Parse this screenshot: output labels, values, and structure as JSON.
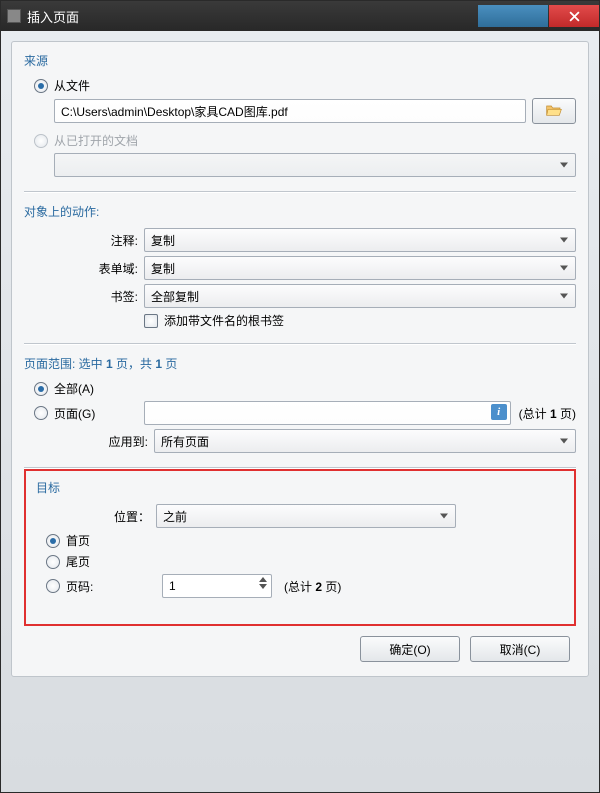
{
  "window": {
    "title": "插入页面"
  },
  "source": {
    "title": "来源",
    "from_file_label": "从文件",
    "file_path": "C:\\Users\\admin\\Desktop\\家具CAD图库.pdf",
    "from_opened_label": "从已打开的文档",
    "opened_doc_value": ""
  },
  "actions": {
    "title": "对象上的动作:",
    "annot_label": "注释:",
    "annot_value": "复制",
    "form_label": "表单域:",
    "form_value": "复制",
    "bookmark_label": "书签:",
    "bookmark_value": "全部复制",
    "add_root_bookmark_label": "添加带文件名的根书签"
  },
  "range": {
    "title_prefix": "页面范围: 选中 ",
    "selected": "1",
    "mid": " 页，共 ",
    "total": "1",
    "suffix": " 页",
    "all_label": "全部(A)",
    "pages_label": "页面(G)",
    "pages_value": "",
    "pages_count_prefix": "(总计 ",
    "pages_count": "1",
    "pages_count_suffix": " 页)",
    "apply_to_label": "应用到:",
    "apply_to_value": "所有页面"
  },
  "target": {
    "title": "目标",
    "position_label": "位置：",
    "position_value": "之前",
    "first_label": "首页",
    "last_label": "尾页",
    "page_no_label": "页码:",
    "page_no_value": "1",
    "count_prefix": "(总计 ",
    "count": "2",
    "count_suffix": " 页)"
  },
  "buttons": {
    "ok": "确定(O)",
    "cancel": "取消(C)"
  }
}
